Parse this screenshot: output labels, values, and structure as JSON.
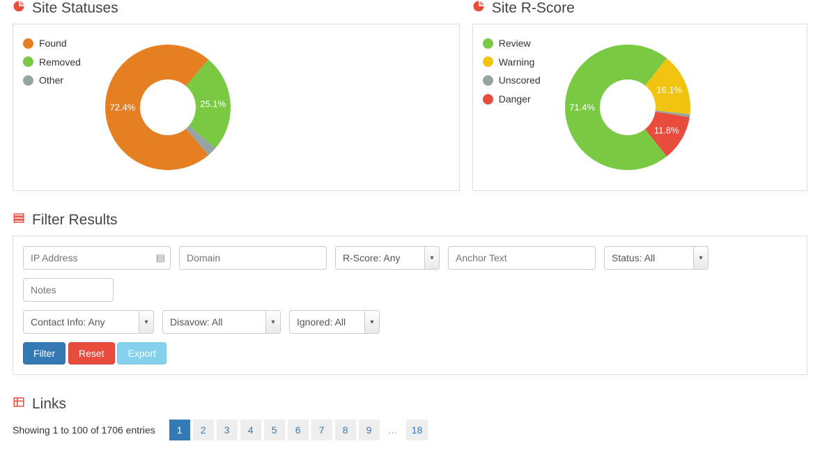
{
  "statuses": {
    "title": "Site Statuses",
    "legend": [
      {
        "label": "Found",
        "color": "#e67e22"
      },
      {
        "label": "Removed",
        "color": "#7ac943"
      },
      {
        "label": "Other",
        "color": "#95a5a6"
      }
    ],
    "slices": [
      {
        "pct": 72.4,
        "label": "72.4%",
        "color": "#e67e22"
      },
      {
        "pct": 25.1,
        "label": "25.1%",
        "color": "#7ac943"
      },
      {
        "pct": 2.5,
        "label": "",
        "color": "#95a5a6"
      }
    ]
  },
  "rscore": {
    "title": "Site R-Score",
    "legend": [
      {
        "label": "Review",
        "color": "#7ac943"
      },
      {
        "label": "Warning",
        "color": "#f1c40f"
      },
      {
        "label": "Unscored",
        "color": "#95a5a6"
      },
      {
        "label": "Danger",
        "color": "#e74c3c"
      }
    ],
    "slices": [
      {
        "pct": 71.4,
        "label": "71.4%",
        "color": "#7ac943"
      },
      {
        "pct": 16.1,
        "label": "16.1%",
        "color": "#f1c40f"
      },
      {
        "pct": 0.7,
        "label": "",
        "color": "#95a5a6"
      },
      {
        "pct": 11.8,
        "label": "11.8%",
        "color": "#e74c3c"
      }
    ]
  },
  "filter": {
    "title": "Filter Results",
    "ip_placeholder": "IP Address",
    "domain_placeholder": "Domain",
    "rscore_selected": "R-Score: Any",
    "anchor_placeholder": "Anchor Text",
    "status_selected": "Status: All",
    "notes_placeholder": "Notes",
    "contact_selected": "Contact Info: Any",
    "disavow_selected": "Disavow: All",
    "ignored_selected": "Ignored: All",
    "btn_filter": "Filter",
    "btn_reset": "Reset",
    "btn_export": "Export"
  },
  "links": {
    "title": "Links",
    "showing": "Showing 1 to 100 of 1706 entries",
    "pages": [
      "1",
      "2",
      "3",
      "4",
      "5",
      "6",
      "7",
      "8",
      "9",
      "…",
      "18"
    ],
    "active_page": "1"
  },
  "chart_data": [
    {
      "type": "pie",
      "title": "Site Statuses",
      "series": [
        {
          "name": "Found",
          "value": 72.4,
          "color": "#e67e22"
        },
        {
          "name": "Removed",
          "value": 25.1,
          "color": "#7ac943"
        },
        {
          "name": "Other",
          "value": 2.5,
          "color": "#95a5a6"
        }
      ],
      "unit": "%",
      "donut": true
    },
    {
      "type": "pie",
      "title": "Site R-Score",
      "series": [
        {
          "name": "Review",
          "value": 71.4,
          "color": "#7ac943"
        },
        {
          "name": "Warning",
          "value": 16.1,
          "color": "#f1c40f"
        },
        {
          "name": "Unscored",
          "value": 0.7,
          "color": "#95a5a6"
        },
        {
          "name": "Danger",
          "value": 11.8,
          "color": "#e74c3c"
        }
      ],
      "unit": "%",
      "donut": true
    }
  ]
}
